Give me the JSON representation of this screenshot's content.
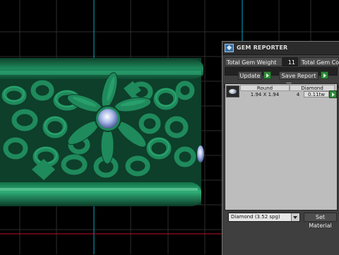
{
  "panel": {
    "title": "GEM REPORTER",
    "total_gem_weight_label": "Total Gem Weight",
    "total_gem_weight_value": "11",
    "total_gem_count_label": "Total Gem Count",
    "update_label": "Update",
    "save_report_label": "Save Report",
    "table": {
      "headers": [
        "Round",
        "Diamond"
      ],
      "rows": [
        {
          "shape_size": "1.94 X 1.94",
          "count": "4",
          "weight": "0.11tw"
        }
      ]
    },
    "material_select": {
      "selected": "Diamond   (3.52 spg)"
    },
    "set_material_label": "Set Material"
  },
  "colors": {
    "ring_green": "#1f8a5c",
    "grid_line": "#2c2c2c",
    "axis_cyan": "#00a8c8",
    "axis_red": "#c0102a"
  }
}
